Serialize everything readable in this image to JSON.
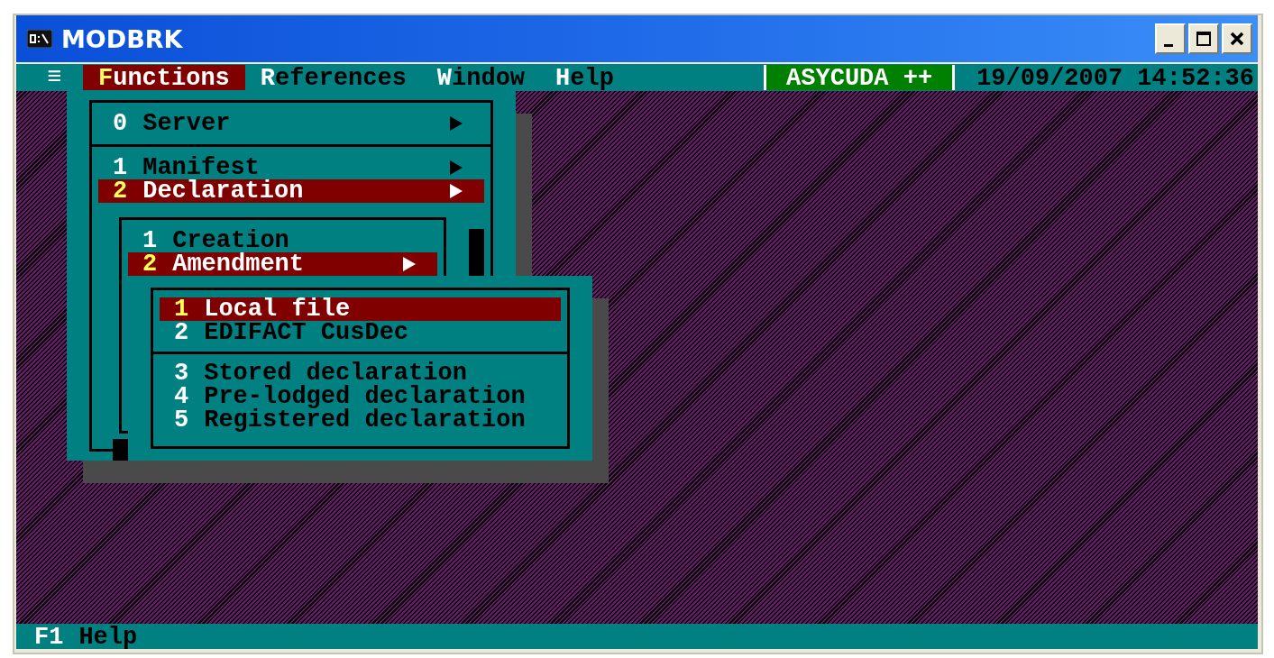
{
  "window": {
    "title": "MODBRK"
  },
  "menu_bar": {
    "menu_glyph": "≡",
    "items": [
      {
        "label": "Functions",
        "selected": true
      },
      {
        "label": "References",
        "selected": false
      },
      {
        "label": "Window",
        "selected": false
      },
      {
        "label": "Help",
        "selected": false
      }
    ],
    "product": "ASYCUDA ++",
    "datetime": "19/09/2007 14:52:36"
  },
  "menus": [
    {
      "sections": [
        [
          {
            "key": "0",
            "label": "Server",
            "submenu": true,
            "selected": false
          }
        ],
        [
          {
            "key": "1",
            "label": "Manifest",
            "submenu": true,
            "selected": false
          },
          {
            "key": "2",
            "label": "Declaration",
            "submenu": true,
            "selected": true
          }
        ]
      ]
    },
    {
      "sections": [
        [
          {
            "key": "1",
            "label": "Creation",
            "submenu": false,
            "selected": false
          },
          {
            "key": "2",
            "label": "Amendment",
            "submenu": true,
            "selected": true
          }
        ]
      ]
    },
    {
      "sections": [
        [
          {
            "key": "1",
            "label": "Local file",
            "submenu": false,
            "selected": true
          },
          {
            "key": "2",
            "label": "EDIFACT CusDec",
            "submenu": false,
            "selected": false
          }
        ],
        [
          {
            "key": "3",
            "label": "Stored declaration",
            "submenu": false,
            "selected": false
          },
          {
            "key": "4",
            "label": "Pre-lodged declaration",
            "submenu": false,
            "selected": false
          },
          {
            "key": "5",
            "label": "Registered declaration",
            "submenu": false,
            "selected": false
          }
        ]
      ]
    }
  ],
  "status_bar": {
    "key": "F1",
    "label": "Help"
  }
}
